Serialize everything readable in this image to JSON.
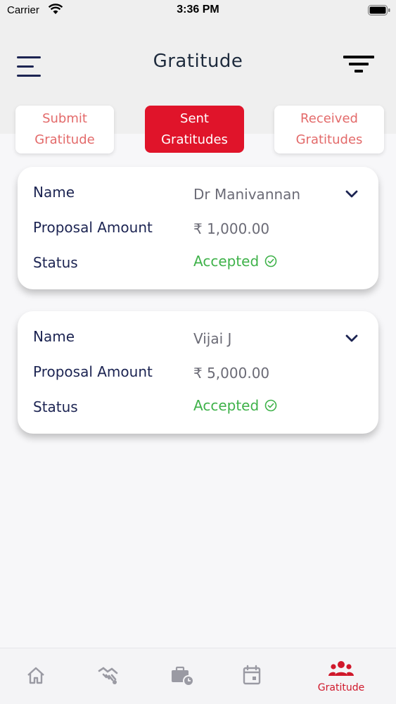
{
  "status_bar": {
    "carrier": "Carrier",
    "time": "3:36 PM"
  },
  "header": {
    "title": "Gratitude"
  },
  "tabs": [
    {
      "label": "Submit\nGratitude",
      "active": false
    },
    {
      "label": "Sent\nGratitudes",
      "active": true
    },
    {
      "label": "Received\nGratitudes",
      "active": false
    }
  ],
  "cards": [
    {
      "name_label": "Name",
      "name_value": "Dr Manivannan",
      "amount_label": "Proposal Amount",
      "amount_value": "₹ 1,000.00",
      "status_label": "Status",
      "status_value": "Accepted"
    },
    {
      "name_label": "Name",
      "name_value": "Vijai J",
      "amount_label": "Proposal Amount",
      "amount_value": "₹ 5,000.00",
      "status_label": "Status",
      "status_value": "Accepted"
    }
  ],
  "tab_bar": {
    "items": [
      "home-icon",
      "handshake-icon",
      "briefcase-clock-icon",
      "calendar-icon",
      "group-icon"
    ],
    "active_label": "Gratitude"
  },
  "colors": {
    "accent": "#e0142a",
    "navy": "#1c2452",
    "success": "#3fb24a"
  }
}
